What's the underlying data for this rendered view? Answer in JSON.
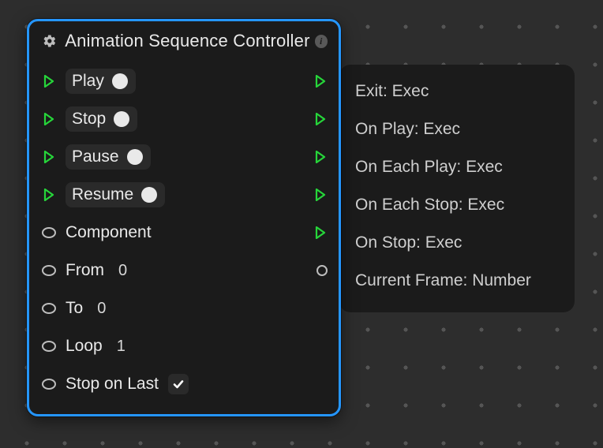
{
  "header": {
    "title": "Animation Sequence Controller"
  },
  "inputs": {
    "play": {
      "label": "Play"
    },
    "stop": {
      "label": "Stop"
    },
    "pause": {
      "label": "Pause"
    },
    "resume": {
      "label": "Resume"
    },
    "component": {
      "label": "Component"
    },
    "from": {
      "label": "From",
      "value": "0"
    },
    "to": {
      "label": "To",
      "value": "0"
    },
    "loop": {
      "label": "Loop",
      "value": "1"
    },
    "stop_on_last": {
      "label": "Stop on Last",
      "checked": true
    }
  },
  "outputs": {
    "exit": {
      "label": "Exit: Exec"
    },
    "on_play": {
      "label": "On Play: Exec"
    },
    "on_each_play": {
      "label": "On Each Play: Exec"
    },
    "on_each_stop": {
      "label": "On Each Stop: Exec"
    },
    "on_stop": {
      "label": "On Stop: Exec"
    },
    "current_frame": {
      "label": "Current Frame: Number"
    }
  },
  "colors": {
    "accent": "#2596ff",
    "exec": "#26d63a"
  }
}
